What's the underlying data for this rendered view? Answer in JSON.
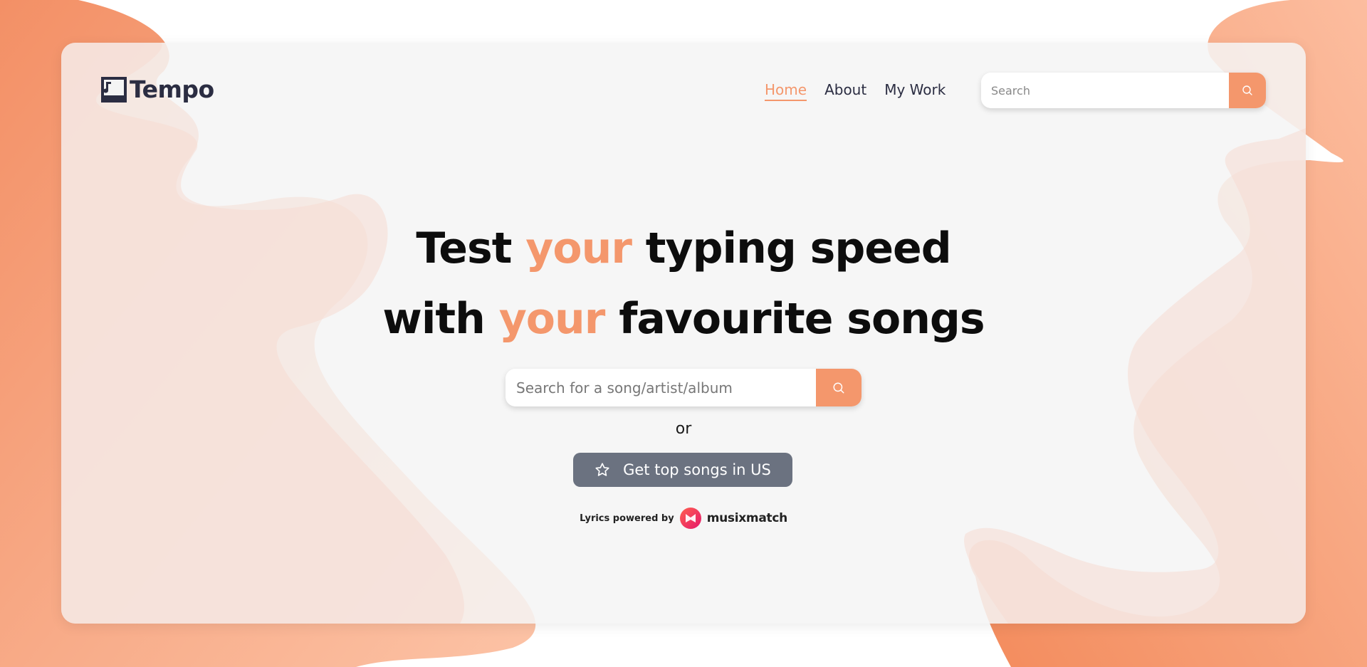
{
  "colors": {
    "accent": "#f4976c",
    "button_gray": "#6b7280",
    "logo_dark": "#2b2d42",
    "card_bg": "#f4f4f4"
  },
  "header": {
    "logo_text": "Tempo",
    "logo_icon": "music-note-icon",
    "nav": [
      {
        "label": "Home",
        "active": true
      },
      {
        "label": "About",
        "active": false
      },
      {
        "label": "My Work",
        "active": false
      }
    ],
    "search": {
      "placeholder": "Search",
      "button_icon": "search-icon"
    }
  },
  "hero": {
    "line1_start": "Test ",
    "line1_accent": "your",
    "line1_end": " typing speed",
    "line2_start": "with ",
    "line2_accent": "your",
    "line2_end": " favourite songs"
  },
  "main_search": {
    "placeholder": "Search for a song/artist/album",
    "button_icon": "search-icon"
  },
  "or_text": "or",
  "top_songs_button": {
    "label": "Get top songs in US",
    "icon": "star-icon"
  },
  "powered_by": {
    "label": "Lyrics powered by",
    "brand": "musixmatch",
    "brand_icon": "musixmatch-logo-icon"
  }
}
